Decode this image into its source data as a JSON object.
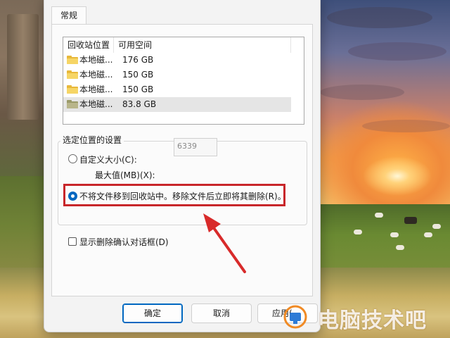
{
  "dialog": {
    "tab_general": "常规",
    "list": {
      "columns": [
        "回收站位置",
        "可用空间"
      ],
      "rows": [
        {
          "name": "本地磁...",
          "space": "176 GB"
        },
        {
          "name": "本地磁...",
          "space": "150 GB"
        },
        {
          "name": "本地磁...",
          "space": "150 GB"
        },
        {
          "name": "本地磁...",
          "space": "83.8 GB"
        }
      ]
    },
    "settings_group_title": "选定位置的设置",
    "custom_size_label": "自定义大小(C):",
    "max_value_label": "最大值(MB)(X):",
    "max_value": "6339",
    "no_move_label": "不将文件移到回收站中。移除文件后立即将其删除(R)。",
    "confirm_delete_label": "显示删除确认对话框(D)",
    "buttons": {
      "ok": "确定",
      "cancel": "取消",
      "apply": "应用("
    }
  },
  "watermark": {
    "text": "电脑技术吧"
  },
  "colors": {
    "accent": "#0067c0",
    "annotation_red": "#c8262a"
  }
}
